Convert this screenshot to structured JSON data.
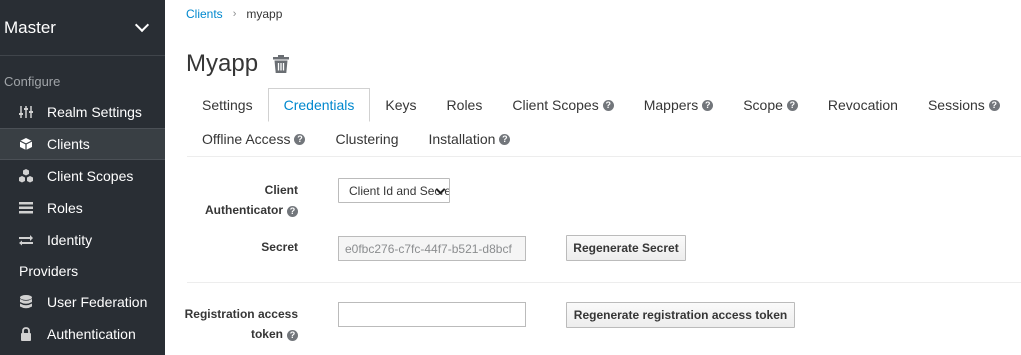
{
  "sidebar": {
    "realm": "Master",
    "section": "Configure",
    "items": [
      {
        "label": "Realm Settings"
      },
      {
        "label": "Clients"
      },
      {
        "label": "Client Scopes"
      },
      {
        "label": "Roles"
      },
      {
        "label": "Identity"
      },
      {
        "label": "Providers"
      },
      {
        "label": "User Federation"
      },
      {
        "label": "Authentication"
      }
    ]
  },
  "breadcrumb": {
    "parent": "Clients",
    "sep": "›",
    "current": "myapp"
  },
  "page": {
    "title": "Myapp"
  },
  "tabs": {
    "row1": [
      "Settings",
      "Credentials",
      "Keys",
      "Roles",
      "Client Scopes",
      "Mappers",
      "Scope",
      "Revocation",
      "Sessions"
    ],
    "row2": [
      "Offline Access",
      "Clustering",
      "Installation"
    ]
  },
  "form": {
    "authenticator_label_1": "Client",
    "authenticator_label_2": "Authenticator",
    "authenticator_value": "Client Id and Secret",
    "secret_label": "Secret",
    "secret_value": "e0fbc276-c7fc-44f7-b521-d8bcf",
    "regen_secret": "Regenerate Secret",
    "reg_token_label_1": "Registration access",
    "reg_token_label_2": "token",
    "reg_token_value": "",
    "regen_token": "Regenerate registration access token"
  },
  "help_glyph": "?"
}
